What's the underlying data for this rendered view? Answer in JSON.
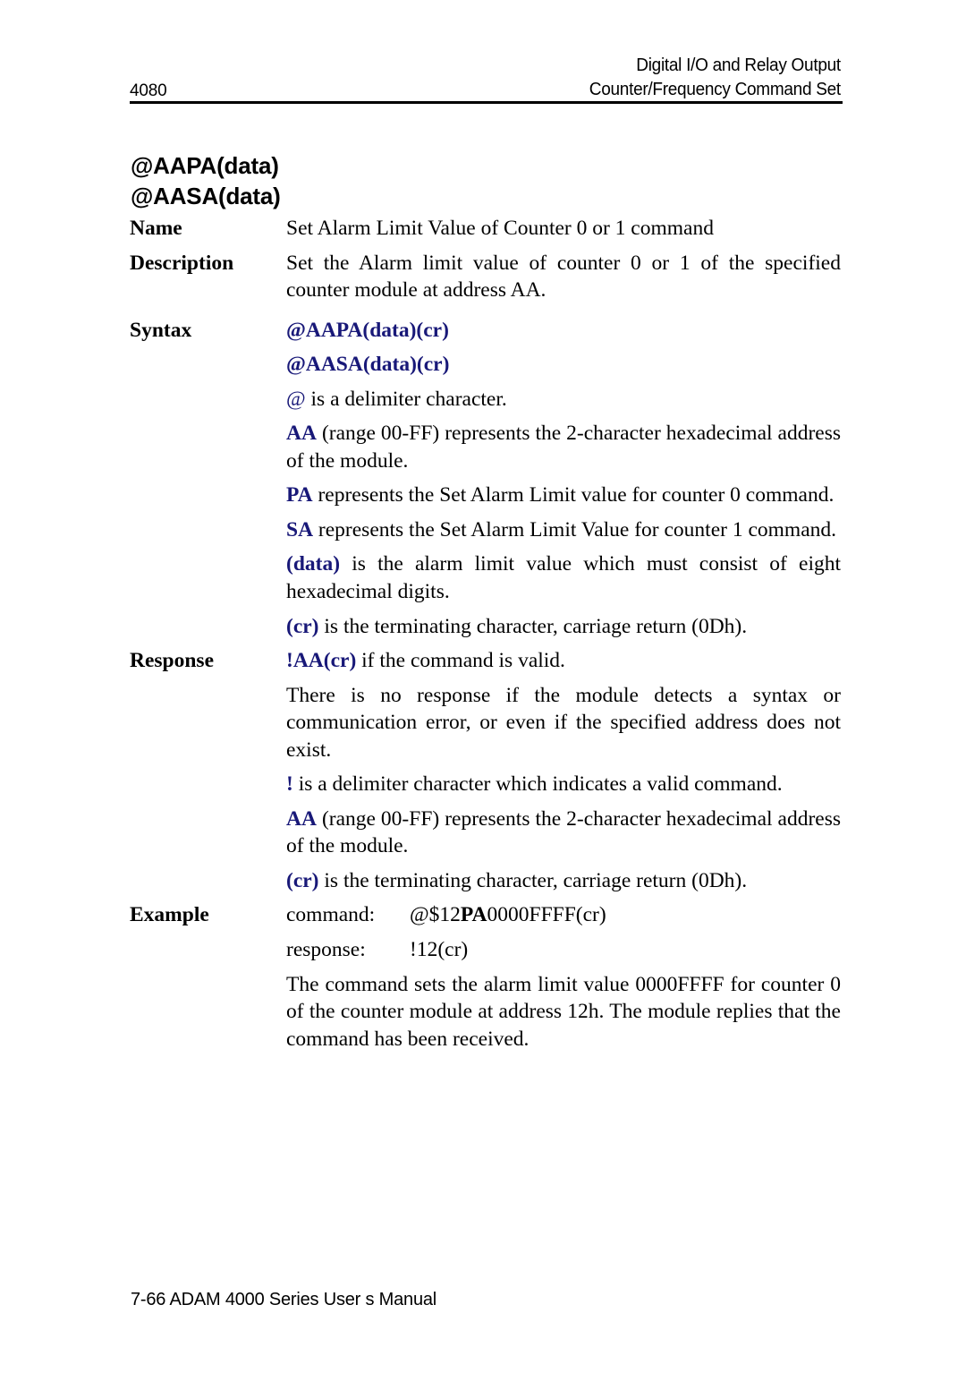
{
  "header": {
    "page_number": "4080",
    "line1": "Digital I/O and Relay Output",
    "line2": "Counter/Frequency Command Set"
  },
  "command_title": {
    "line1": "@AAPA(data)",
    "line2": "@AASA(data)"
  },
  "sections": {
    "name": {
      "label": "Name",
      "text": "Set Alarm Limit Value of Counter 0 or 1 command"
    },
    "description": {
      "label": "Description",
      "text": "Set the Alarm limit value of counter 0 or 1 of the specified counter module at address AA."
    },
    "syntax": {
      "label": "Syntax",
      "line1": "@AAPA(data)(cr)",
      "line2": "@AASA(data)(cr)",
      "notes": [
        {
          "token": "@",
          "token_bold": false,
          "text": " is a delimiter character."
        },
        {
          "token": "AA",
          "token_bold": true,
          "text": " (range 00-FF) represents the 2-character hexadecimal address of the module."
        },
        {
          "token": "PA",
          "token_bold": true,
          "text": " represents the Set Alarm Limit value for counter 0 command."
        },
        {
          "token": "SA",
          "token_bold": true,
          "text": " represents the Set Alarm Limit Value for counter 1 command."
        },
        {
          "token": "(data)",
          "token_bold": true,
          "text": " is the alarm limit value which must consist of eight hexadecimal digits."
        },
        {
          "token": "(cr)",
          "token_bold": true,
          "text": " is the terminating character, carriage return (0Dh)."
        }
      ]
    },
    "response": {
      "label": "Response",
      "valid_token": "!AA(cr)",
      "valid_text": " if the command is valid.",
      "no_response_text": "There is no response if the module detects a syntax or communication error, or even if the specified address does not exist.",
      "notes": [
        {
          "token": "!",
          "token_bold": true,
          "text": " is a delimiter character which indicates a valid command."
        },
        {
          "token": "AA",
          "token_bold": true,
          "text": " (range 00-FF) represents the 2-character hexadecimal address of the module."
        },
        {
          "token": "(cr)",
          "token_bold": true,
          "text": " is the terminating character, carriage return (0Dh)."
        }
      ]
    },
    "example": {
      "label": "Example",
      "command_key": "command:",
      "command_prefix": "@$12",
      "command_bold": "PA",
      "command_suffix": "0000FFFF(cr)",
      "response_key": "response:",
      "response_value": "!12(cr)",
      "explanation": "The command sets the alarm limit value 0000FFFF for counter 0 of the counter module at address 12h.  The module replies that the command has been received."
    }
  },
  "footer": {
    "text": "7-66 ADAM 4000 Series User s Manual"
  },
  "colors": {
    "accent_blue": "#181878",
    "text_black": "#000000",
    "background": "#ffffff"
  }
}
